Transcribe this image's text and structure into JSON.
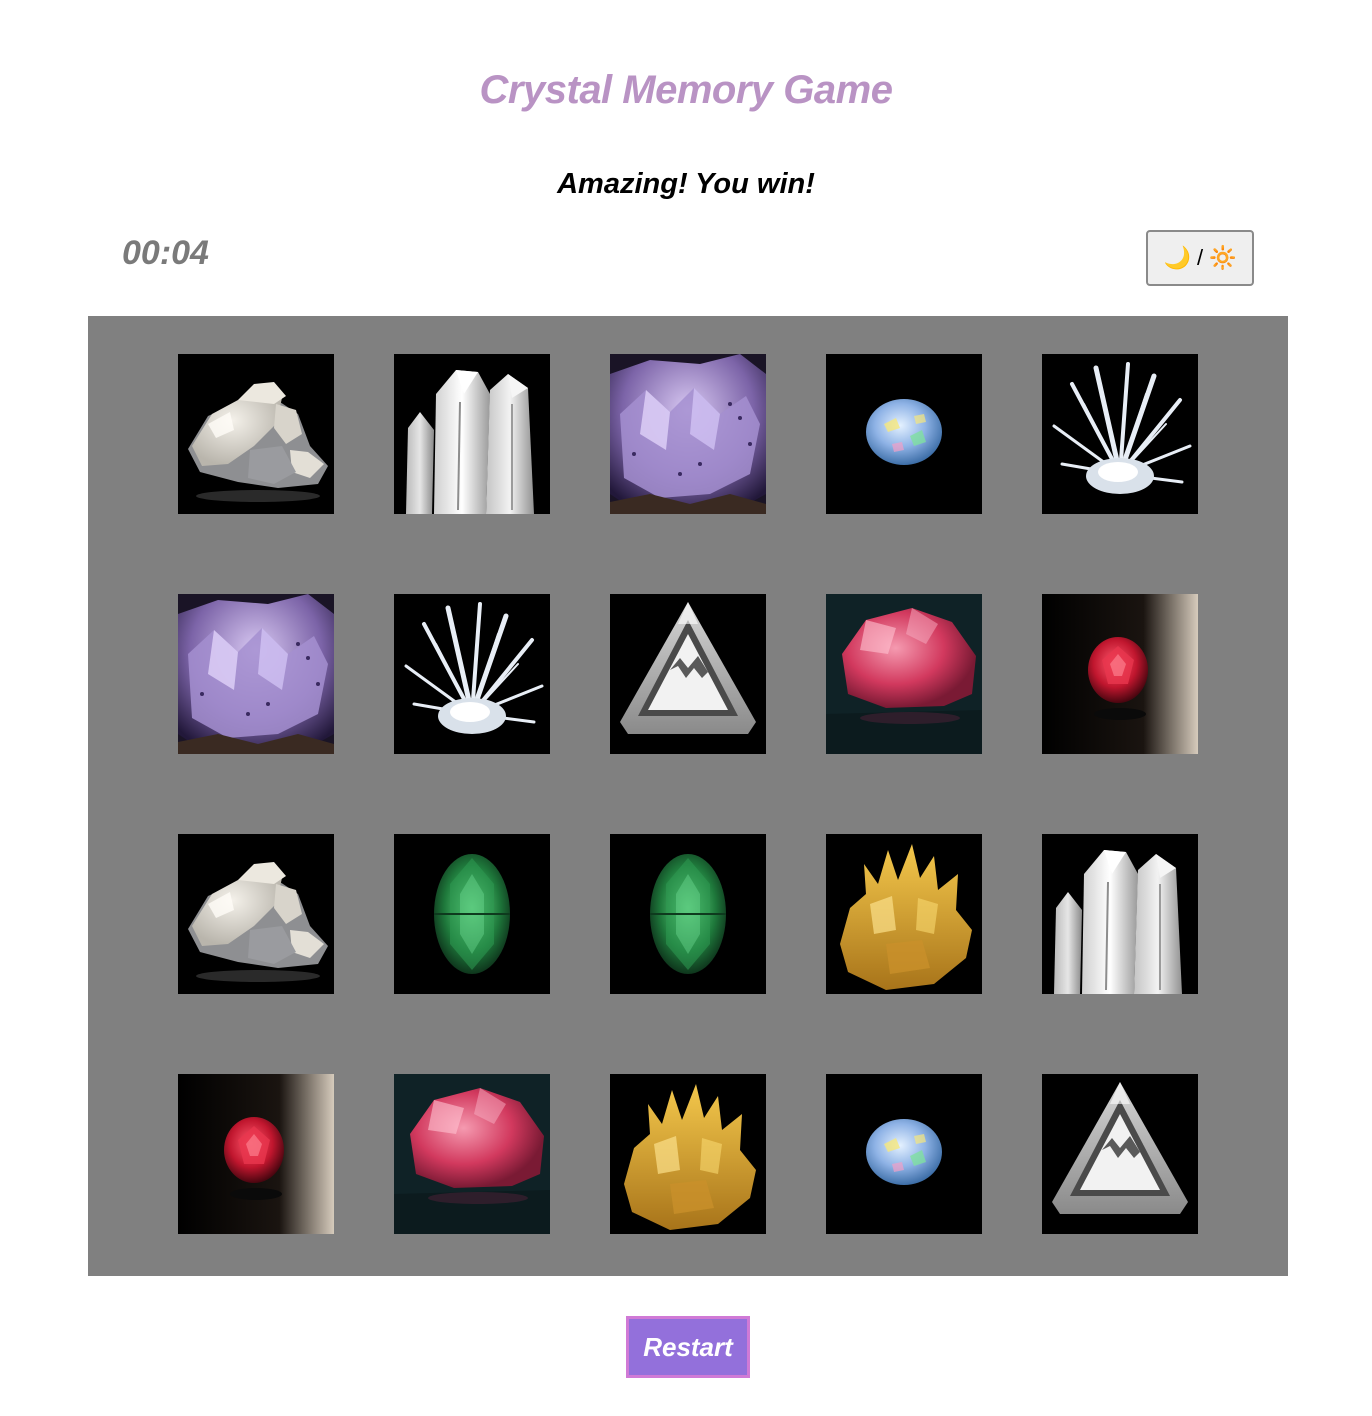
{
  "header": {
    "title": "Crystal Memory Game",
    "status": "Amazing! You win!"
  },
  "timer": {
    "value": "00:04"
  },
  "theme_toggle": {
    "moon": "🌙",
    "separator": "/",
    "sun": "🔆"
  },
  "board": {
    "rows": 4,
    "columns": 5,
    "cards": [
      {
        "crystal": "calcite-cluster",
        "matched": true
      },
      {
        "crystal": "quartz-points",
        "matched": true
      },
      {
        "crystal": "amethyst-fluorite",
        "matched": true
      },
      {
        "crystal": "opal-cabochon",
        "matched": true
      },
      {
        "crystal": "clear-needle-cluster",
        "matched": true
      },
      {
        "crystal": "amethyst-fluorite",
        "matched": true
      },
      {
        "crystal": "clear-needle-cluster",
        "matched": true
      },
      {
        "crystal": "diamond-trigon",
        "matched": true
      },
      {
        "crystal": "rough-pink-spinel",
        "matched": true
      },
      {
        "crystal": "faceted-red-ruby",
        "matched": true
      },
      {
        "crystal": "calcite-cluster",
        "matched": true
      },
      {
        "crystal": "faceted-green-emerald",
        "matched": true
      },
      {
        "crystal": "faceted-green-emerald",
        "matched": true
      },
      {
        "crystal": "golden-wulfenite",
        "matched": true
      },
      {
        "crystal": "quartz-points",
        "matched": true
      },
      {
        "crystal": "faceted-red-ruby",
        "matched": true
      },
      {
        "crystal": "rough-pink-spinel",
        "matched": true
      },
      {
        "crystal": "golden-wulfenite",
        "matched": true
      },
      {
        "crystal": "opal-cabochon",
        "matched": true
      },
      {
        "crystal": "diamond-trigon",
        "matched": true
      }
    ]
  },
  "controls": {
    "restart_label": "Restart"
  },
  "colors": {
    "title": "#b993c4",
    "board_background": "#808080",
    "restart_background": "#9370db",
    "restart_border": "#d07ad6",
    "timer": "#7a7a7a"
  }
}
